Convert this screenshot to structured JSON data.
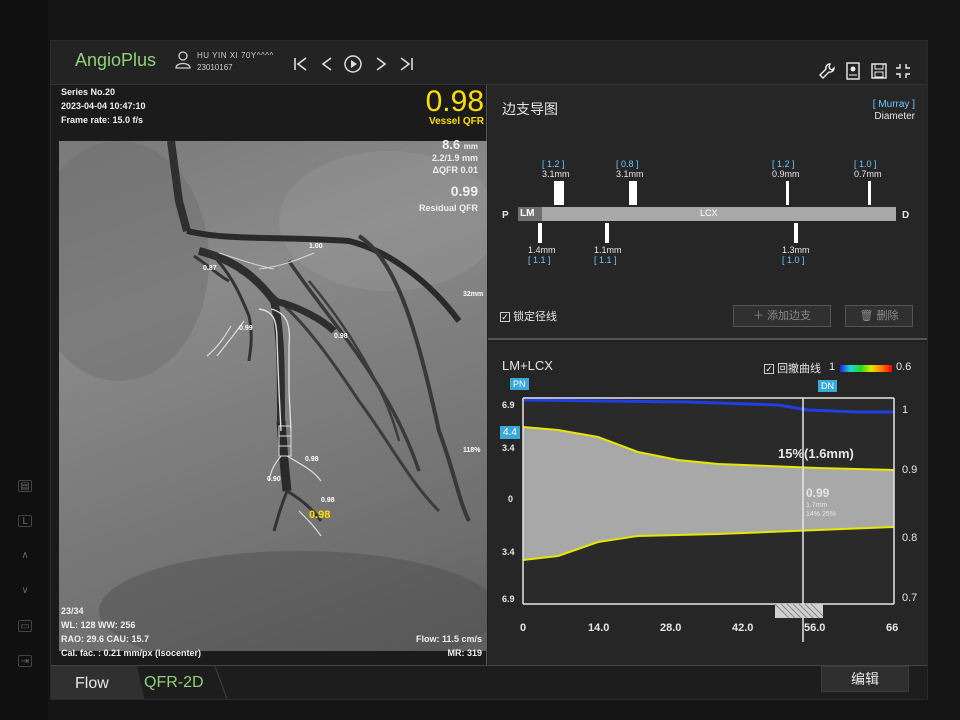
{
  "app": {
    "brand": "AngioPlus",
    "patient_name": "HU YIN XI 70Y^^^^",
    "patient_id": "23010167"
  },
  "image_panel": {
    "series": "Series No.20",
    "datetime": "2023-04-04 10:47:10",
    "frame_rate": "Frame rate: 15.0 f/s",
    "vessel_qfr_value": "0.98",
    "vessel_qfr_label": "Vessel QFR",
    "length_value": "8.6",
    "length_unit": "mm",
    "diam_range": "2.2/1.9 mm",
    "delta_qfr": "ΔQFR  0.01",
    "residual_value": "0.99",
    "residual_label": "Residual QFR",
    "frame_index": "23/34",
    "wl_ww": "WL: 128 WW: 256",
    "rao_cau": "RAO: 29.6 CAU: 15.7",
    "cal_factor": "Cal. fac. : 0.21 mm/px (Isocenter)",
    "flow": "Flow: 11.5 cm/s",
    "mr": "MR: 319",
    "scale_top": "32mm",
    "scale_bottom": "118%",
    "vessel_labels": [
      "1.00",
      "0.87",
      "0.99",
      "0.98",
      "0.98",
      "0.90",
      "0.98"
    ],
    "highlight_label": "0.98"
  },
  "branch_panel": {
    "title": "边支导图",
    "murray": "[ Murray ]",
    "diameter": "Diameter",
    "p_label": "P",
    "d_label": "D",
    "lm_label": "LM",
    "lcx_label": "LCX",
    "upper_branches": [
      {
        "bracket": "[ 1.2 ]",
        "value": "3.1mm"
      },
      {
        "bracket": "[ 0.8 ]",
        "value": "3.1mm"
      },
      {
        "bracket": "[ 1.2 ]",
        "value": "0.9mm"
      },
      {
        "bracket": "[ 1.0 ]",
        "value": "0.7mm"
      }
    ],
    "lower_branches": [
      {
        "value": "1.4mm",
        "bracket": "[ 1.1 ]"
      },
      {
        "value": "1.1mm",
        "bracket": "[ 1.1 ]"
      },
      {
        "value": "1.3mm",
        "bracket": "[ 1.0 ]"
      }
    ],
    "lock_label": "锁定径线",
    "add_button": "添加边支",
    "delete_button": "删除"
  },
  "curve_panel": {
    "title": "LM+LCX",
    "pullback_label": "回撤曲线",
    "scale_min": "1",
    "scale_max": "0.6",
    "pn_tag": "PN",
    "dn_tag": "DN",
    "left_marker": "4.4",
    "y_left": [
      "6.9",
      "3.4",
      "0",
      "3.4",
      "6.9"
    ],
    "y_right": [
      "1",
      "0.9",
      "0.8",
      "0.7"
    ],
    "x_ticks": [
      "0",
      "14.0",
      "28.0",
      "42.0",
      "56.0",
      "66"
    ],
    "stenosis_label": "15%(1.6mm)",
    "cursor_qfr": "0.99",
    "cursor_diam": "1.7mm",
    "cursor_pct": "14% 25%"
  },
  "bottom": {
    "tab_flow": "Flow",
    "tab_qfr": "QFR-2D",
    "edit_button": "编辑"
  },
  "colors": {
    "brand": "#8fd27a",
    "qfr": "#ffde00",
    "accent_blue": "#3aa8d8",
    "curve_yellow": "#e6e600",
    "qfr_line": "#1f3fe0"
  }
}
